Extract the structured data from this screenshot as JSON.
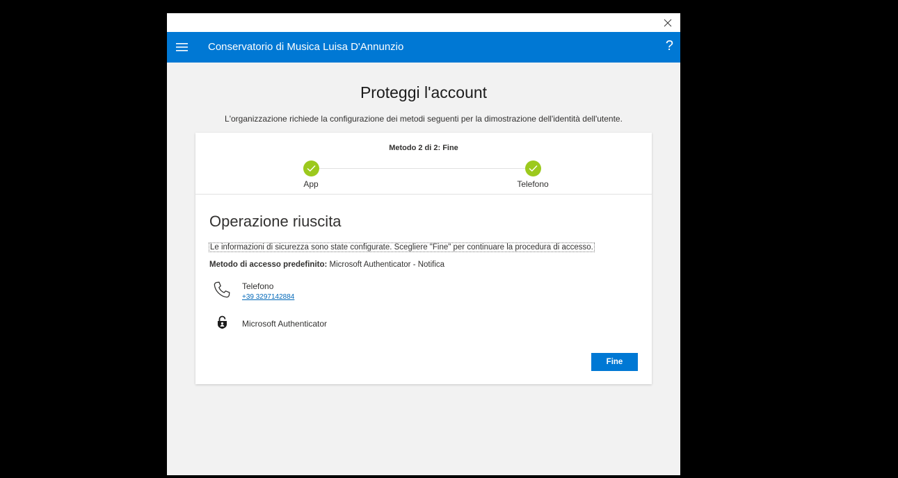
{
  "window": {
    "close_label": "×"
  },
  "header": {
    "title": "Conservatorio di Musica Luisa D'Annunzio",
    "help_label": "?"
  },
  "page": {
    "title": "Proteggi l'account",
    "subtitle": "L'organizzazione richiede la configurazione dei metodi seguenti per la dimostrazione dell'identità dell'utente."
  },
  "stepper": {
    "heading": "Metodo 2 di 2: Fine",
    "steps": [
      {
        "label": "App",
        "status": "completed"
      },
      {
        "label": "Telefono",
        "status": "completed"
      }
    ],
    "completed_color": "#9cc91d"
  },
  "result": {
    "title": "Operazione riuscita",
    "info": "Le informazioni di sicurezza sono state configurate. Scegliere \"Fine\" per continuare la procedura di accesso.",
    "default_method_label": "Metodo di accesso predefinito:",
    "default_method_value": " Microsoft Authenticator - Notifica",
    "methods": [
      {
        "icon": "phone-icon",
        "label": "Telefono",
        "detail": "+39 3297142884"
      },
      {
        "icon": "authenticator-lock-icon",
        "label": "Microsoft Authenticator"
      }
    ]
  },
  "actions": {
    "finish_label": "Fine"
  },
  "colors": {
    "brand": "#0078d4",
    "background": "#f2f2f2",
    "link": "#0067b8"
  }
}
